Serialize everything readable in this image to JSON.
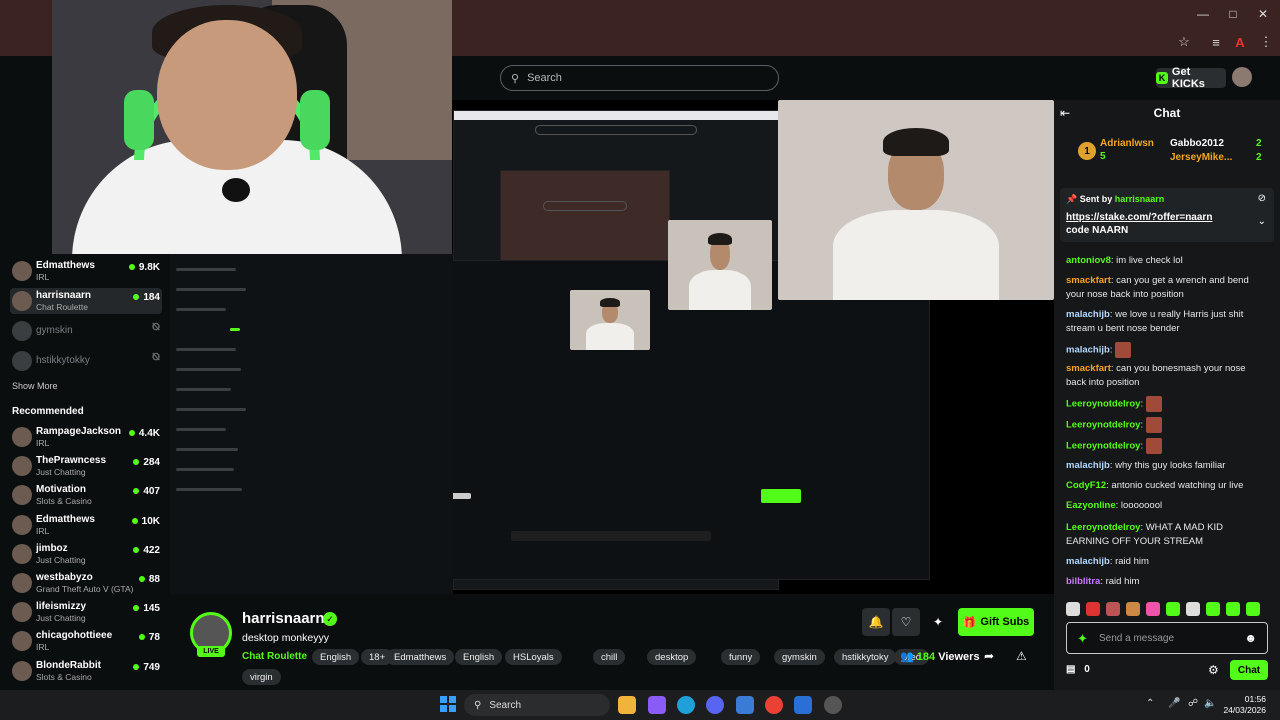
{
  "search": {
    "placeholder": "Search"
  },
  "header": {
    "get_kicks": "Get KICKs"
  },
  "sidebar": {
    "following": [
      {
        "name": "Edmatthews",
        "category": "IRL",
        "viewers": "9.8K",
        "live": true,
        "active": false
      },
      {
        "name": "harrisnaarn",
        "category": "Chat Roulette",
        "viewers": "184",
        "live": true,
        "active": true
      },
      {
        "name": "gymskin",
        "category": "",
        "viewers": "",
        "live": false,
        "active": false
      },
      {
        "name": "hstikkytokky",
        "category": "",
        "viewers": "",
        "live": false,
        "active": false
      }
    ],
    "show_more": "Show More",
    "recommended_title": "Recommended",
    "recommended": [
      {
        "name": "RampageJackson",
        "category": "IRL",
        "viewers": "4.4K"
      },
      {
        "name": "ThePrawncess",
        "category": "Just Chatting",
        "viewers": "284"
      },
      {
        "name": "Motivation",
        "category": "Slots & Casino",
        "viewers": "407"
      },
      {
        "name": "Edmatthews",
        "category": "IRL",
        "viewers": "10K"
      },
      {
        "name": "jimboz",
        "category": "Just Chatting",
        "viewers": "422"
      },
      {
        "name": "westbabyzo",
        "category": "Grand Theft Auto V (GTA)",
        "viewers": "88"
      },
      {
        "name": "lifeismizzy",
        "category": "Just Chatting",
        "viewers": "145"
      },
      {
        "name": "chicagohottieee",
        "category": "IRL",
        "viewers": "78"
      },
      {
        "name": "BlondeRabbit",
        "category": "Slots & Casino",
        "viewers": "749"
      }
    ]
  },
  "stream": {
    "channel": "harrisnaarn",
    "live_label": "LIVE",
    "title": "desktop monkeyyy",
    "category": "Chat Roulette",
    "tags": [
      "English",
      "18+",
      "Edmatthews",
      "English",
      "HSLoyals",
      "chill",
      "desktop",
      "funny",
      "gymskin",
      "hstikkytoky",
      "pred",
      "virgin"
    ],
    "gift_subs": "Gift Subs",
    "viewers": "184",
    "viewers_label": "Viewers"
  },
  "chat": {
    "title": "Chat",
    "leaderboard": [
      {
        "rank": "1",
        "name": "Adrianlwsn",
        "count": "5"
      },
      {
        "name": "Gabbo2012",
        "count": "2"
      },
      {
        "name": "JerseyMike...",
        "count": "2"
      }
    ],
    "pinned": {
      "sent_by": "Sent by",
      "user": "harrisnaarn",
      "link": "https://stake.com/?offer=naarn",
      "code": "code NAARN"
    },
    "messages": [
      {
        "user": "antoniov8",
        "color": "#53fc18",
        "text": "im live check lol",
        "emote": false
      },
      {
        "user": "smackfart",
        "color": "#f5a623",
        "text": "can you get a wrench and bend your nose back into position",
        "emote": false
      },
      {
        "user": "malachijb",
        "color": "#b7d9ff",
        "text": "we love u really Harris just shit stream u bent nose bender",
        "emote": false
      },
      {
        "user": "malachijb",
        "color": "#b7d9ff",
        "text": "",
        "emote": true
      },
      {
        "user": "smackfart",
        "color": "#f5a623",
        "text": "can you bonesmash your nose back into position",
        "emote": false
      },
      {
        "user": "Leeroynotdelroy",
        "color": "#53fc18",
        "text": "",
        "emote": true
      },
      {
        "user": "Leeroynotdelroy",
        "color": "#53fc18",
        "text": "",
        "emote": true
      },
      {
        "user": "Leeroynotdelroy",
        "color": "#53fc18",
        "text": "",
        "emote": true
      },
      {
        "user": "malachijb",
        "color": "#b7d9ff",
        "text": "why this guy looks familiar",
        "emote": false
      },
      {
        "user": "CodyF12",
        "color": "#53fc18",
        "text": "antonio cucked watching ur live",
        "emote": false
      },
      {
        "user": "Eazyonline",
        "color": "#53fc18",
        "text": "loooooool",
        "emote": false
      },
      {
        "user": "Leeroynotdelroy",
        "color": "#53fc18",
        "text": "WHAT A MAD KID EARNING OFF YOUR STREAM",
        "emote": false
      },
      {
        "user": "malachijb",
        "color": "#b7d9ff",
        "text": "raid him",
        "emote": false
      },
      {
        "user": "bilblitra",
        "color": "#c77dff",
        "text": "raid him",
        "emote": false
      }
    ],
    "input_placeholder": "Send a message",
    "kicks_count": "0",
    "send_label": "Chat"
  },
  "taskbar": {
    "search": "Search",
    "time": "01:56",
    "date": "24/03/2026"
  },
  "colors": {
    "accent": "#53fc18",
    "background": "#0b0e0f",
    "chat_bg": "#151719"
  }
}
